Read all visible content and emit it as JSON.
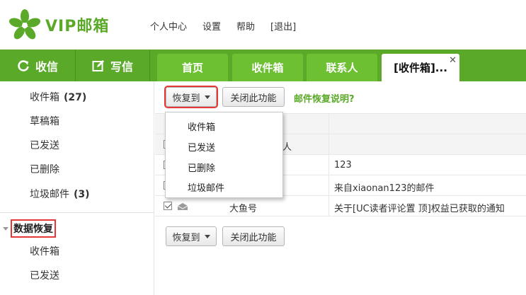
{
  "header": {
    "logo_text": "VIP邮箱",
    "nav": [
      "个人中心",
      "设置",
      "帮助",
      "[退出]"
    ]
  },
  "actions": {
    "receive": "收信",
    "write": "写信"
  },
  "tabs": {
    "home": "首页",
    "inbox": "收件箱",
    "contacts": "联系人",
    "active": "[收件箱]...",
    "close": "✕"
  },
  "sidebar": {
    "inbox": {
      "label": "收件箱",
      "count": "(27)"
    },
    "drafts": {
      "label": "草稿箱"
    },
    "sent": {
      "label": "已发送"
    },
    "deleted": {
      "label": "已删除"
    },
    "spam": {
      "label": "垃圾邮件",
      "count": "(3)"
    },
    "recovery_section": "数据恢复",
    "recovery_items": [
      "收件箱",
      "已发送"
    ]
  },
  "toolbar": {
    "restore_label": "恢复到",
    "close_feature_label": "关闭此功能",
    "help_link": "邮件恢复说明?"
  },
  "table": {
    "header_partial": "人",
    "rows": [
      {
        "sender": "",
        "subject": "123"
      },
      {
        "sender": "",
        "subject": "来自xiaonan123的邮件"
      },
      {
        "sender": "大鱼号",
        "subject": "关于[UC读者评论置 顶]权益已获取的通知"
      }
    ]
  },
  "dropdown": {
    "items": [
      "收件箱",
      "已发送",
      "已删除",
      "垃圾邮件"
    ]
  },
  "colors": {
    "brand_green": "#5aa928",
    "tab_green": "#6ec033",
    "highlight_red": "#e53935"
  }
}
